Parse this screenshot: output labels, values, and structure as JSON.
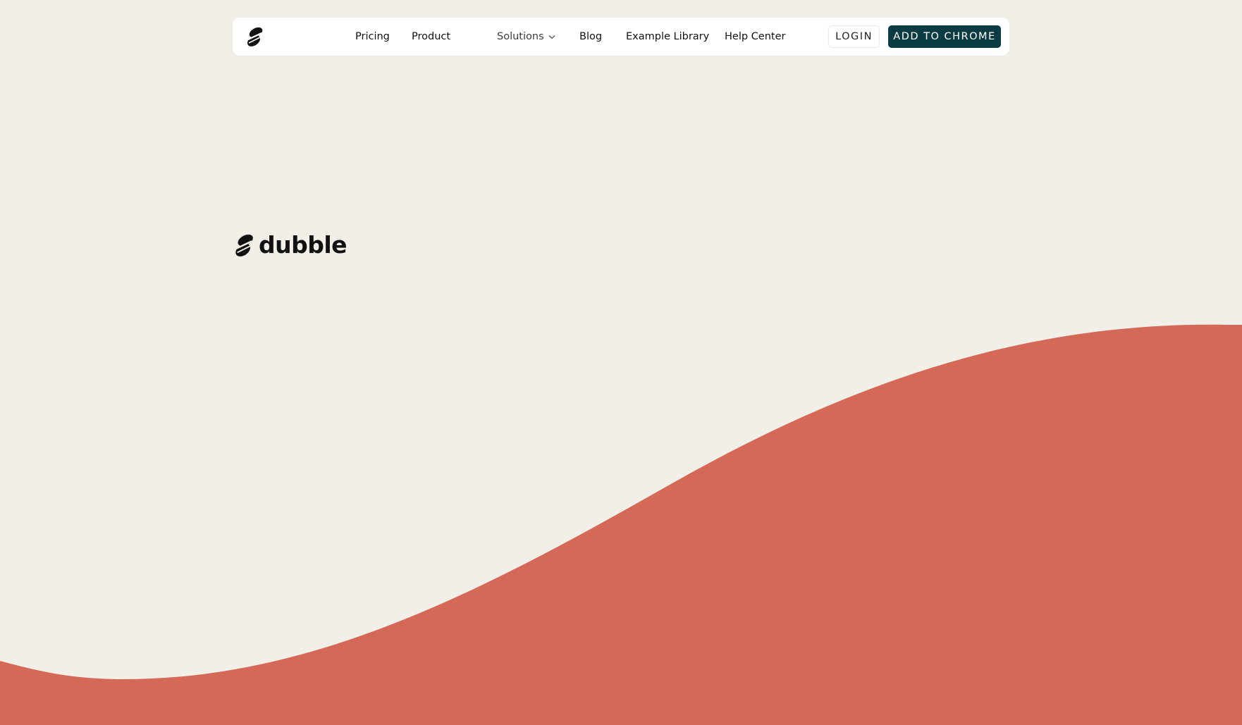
{
  "nav": {
    "logo_icon": "dubble-logo-icon",
    "links": [
      {
        "label": "Pricing"
      },
      {
        "label": "Product"
      },
      {
        "label": "Solutions",
        "icon": "chevron-down-icon"
      },
      {
        "label": "Blog"
      },
      {
        "label": "Example Library"
      },
      {
        "label": "Help Center"
      }
    ],
    "login_label": "LOGIN",
    "cta_label": "ADD TO CHROME"
  },
  "hero": {
    "brand_name": "dubble"
  },
  "colors": {
    "background": "#f2efe9",
    "accent_wave": "#d56958",
    "cta_bg": "#0b3c44",
    "nav_bg": "#ffffff",
    "text": "#111111"
  }
}
